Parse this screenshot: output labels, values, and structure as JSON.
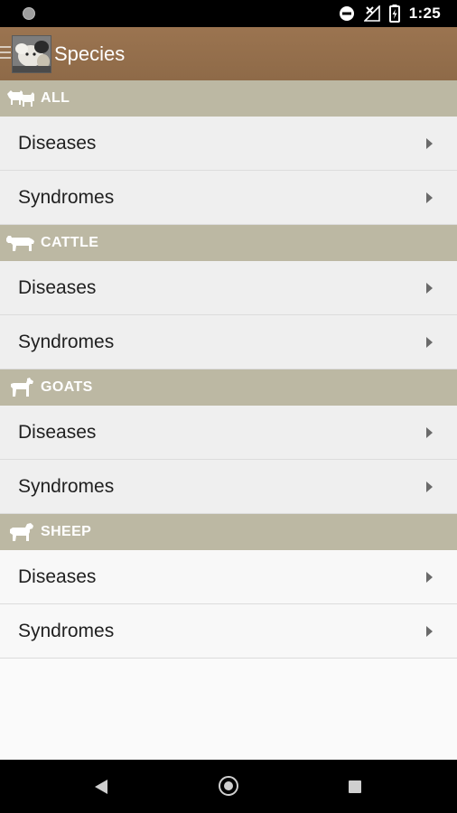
{
  "status_bar": {
    "time": "1:25",
    "icons": [
      "notification-dot-icon",
      "do-not-disturb-icon",
      "no-signal-icon",
      "battery-charging-icon"
    ]
  },
  "app_bar": {
    "title": "Species",
    "icons": [
      "menu-icon",
      "app-logo-icon"
    ],
    "background": "#8e6a48"
  },
  "sections": [
    {
      "label": "ALL",
      "icon": "multi-animal-icon",
      "items": [
        {
          "label": "Diseases"
        },
        {
          "label": "Syndromes"
        }
      ]
    },
    {
      "label": "CATTLE",
      "icon": "cattle-icon",
      "items": [
        {
          "label": "Diseases"
        },
        {
          "label": "Syndromes"
        }
      ]
    },
    {
      "label": "GOATS",
      "icon": "goat-icon",
      "items": [
        {
          "label": "Diseases"
        },
        {
          "label": "Syndromes"
        }
      ]
    },
    {
      "label": "SHEEP",
      "icon": "sheep-icon",
      "items": [
        {
          "label": "Diseases"
        },
        {
          "label": "Syndromes"
        }
      ]
    }
  ],
  "colors": {
    "section_header": "#bcb8a3",
    "row_background": "#efefef",
    "app_bar": "#8e6a48"
  },
  "nav_bar": {
    "icons": [
      "back-icon",
      "home-icon",
      "recents-icon"
    ]
  }
}
